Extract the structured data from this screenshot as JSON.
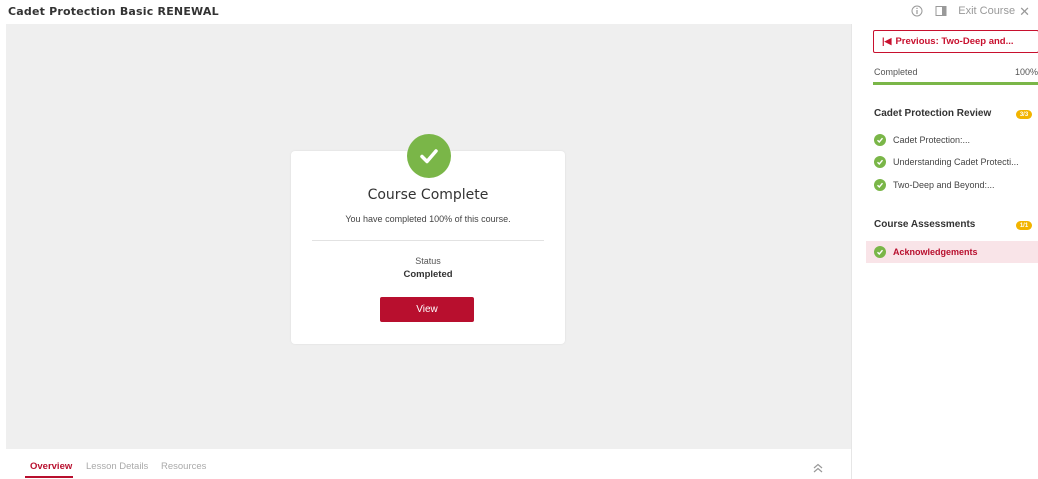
{
  "header": {
    "course_title": "Cadet Protection Basic RENEWAL",
    "info_icon": "info-icon",
    "sidebar_toggle_icon": "sidebar-toggle-icon",
    "exit_label": "Exit Course"
  },
  "main": {
    "card": {
      "icon": "check-circle-icon",
      "title": "Course Complete",
      "subtitle": "You have completed 100% of this course.",
      "status_label": "Status",
      "status_value": "Completed",
      "button_label": "View"
    }
  },
  "bottom_tabs": {
    "tabs": [
      {
        "label": "Overview",
        "active": true
      },
      {
        "label": "Lesson Details",
        "active": false
      },
      {
        "label": "Resources",
        "active": false
      }
    ],
    "collapse_icon": "chevron-double-up-icon"
  },
  "sidebar": {
    "previous_label": "Previous: Two-Deep and...",
    "progress": {
      "label": "Completed",
      "value": "100%",
      "fraction": 1.0
    },
    "sections": [
      {
        "title": "Cadet Protection Review",
        "badge": "3/3",
        "lessons": [
          {
            "label": "Cadet Protection:...",
            "active": false
          },
          {
            "label": "Understanding Cadet Protecti...",
            "active": false
          },
          {
            "label": "Two-Deep and Beyond:...",
            "active": false
          }
        ]
      },
      {
        "title": "Course Assessments",
        "badge": "1/1",
        "lessons": [
          {
            "label": "Acknowledgements",
            "active": true
          }
        ]
      }
    ]
  },
  "colors": {
    "brand_red": "#b80f2e",
    "success_green": "#7ab648",
    "badge_yellow": "#f2b400",
    "active_row_bg": "#f9e4e8"
  }
}
